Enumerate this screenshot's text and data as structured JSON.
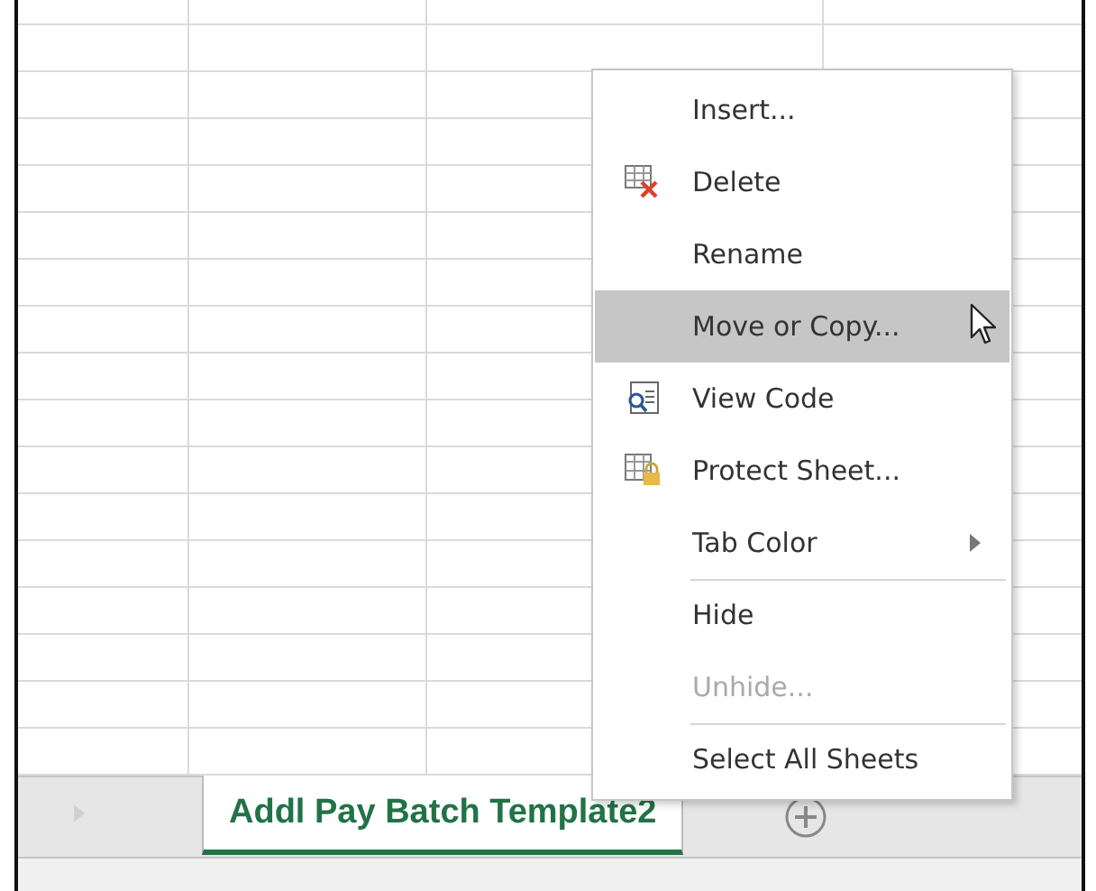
{
  "context_menu": {
    "items": [
      {
        "kind": "plain",
        "label": "Insert...",
        "selected": false,
        "disabled": false,
        "submenu": false,
        "separator_before": false
      },
      {
        "kind": "delete",
        "label": "Delete",
        "selected": false,
        "disabled": false,
        "submenu": false,
        "separator_before": false
      },
      {
        "kind": "plain",
        "label": "Rename",
        "selected": false,
        "disabled": false,
        "submenu": false,
        "separator_before": false
      },
      {
        "kind": "plain",
        "label": "Move or Copy...",
        "selected": true,
        "disabled": false,
        "submenu": false,
        "separator_before": false
      },
      {
        "kind": "view-code",
        "label": "View Code",
        "selected": false,
        "disabled": false,
        "submenu": false,
        "separator_before": false
      },
      {
        "kind": "protect",
        "label": "Protect Sheet...",
        "selected": false,
        "disabled": false,
        "submenu": false,
        "separator_before": false
      },
      {
        "kind": "plain",
        "label": "Tab Color",
        "selected": false,
        "disabled": false,
        "submenu": true,
        "separator_before": false
      },
      {
        "kind": "plain",
        "label": "Hide",
        "selected": false,
        "disabled": false,
        "submenu": false,
        "separator_before": true
      },
      {
        "kind": "plain",
        "label": "Unhide...",
        "selected": false,
        "disabled": true,
        "submenu": false,
        "separator_before": false
      },
      {
        "kind": "plain",
        "label": "Select All Sheets",
        "selected": false,
        "disabled": false,
        "submenu": false,
        "separator_before": true
      }
    ]
  },
  "sheet_tabs": [
    {
      "label": "Addl Pay Batch Template2",
      "selected": true
    }
  ]
}
